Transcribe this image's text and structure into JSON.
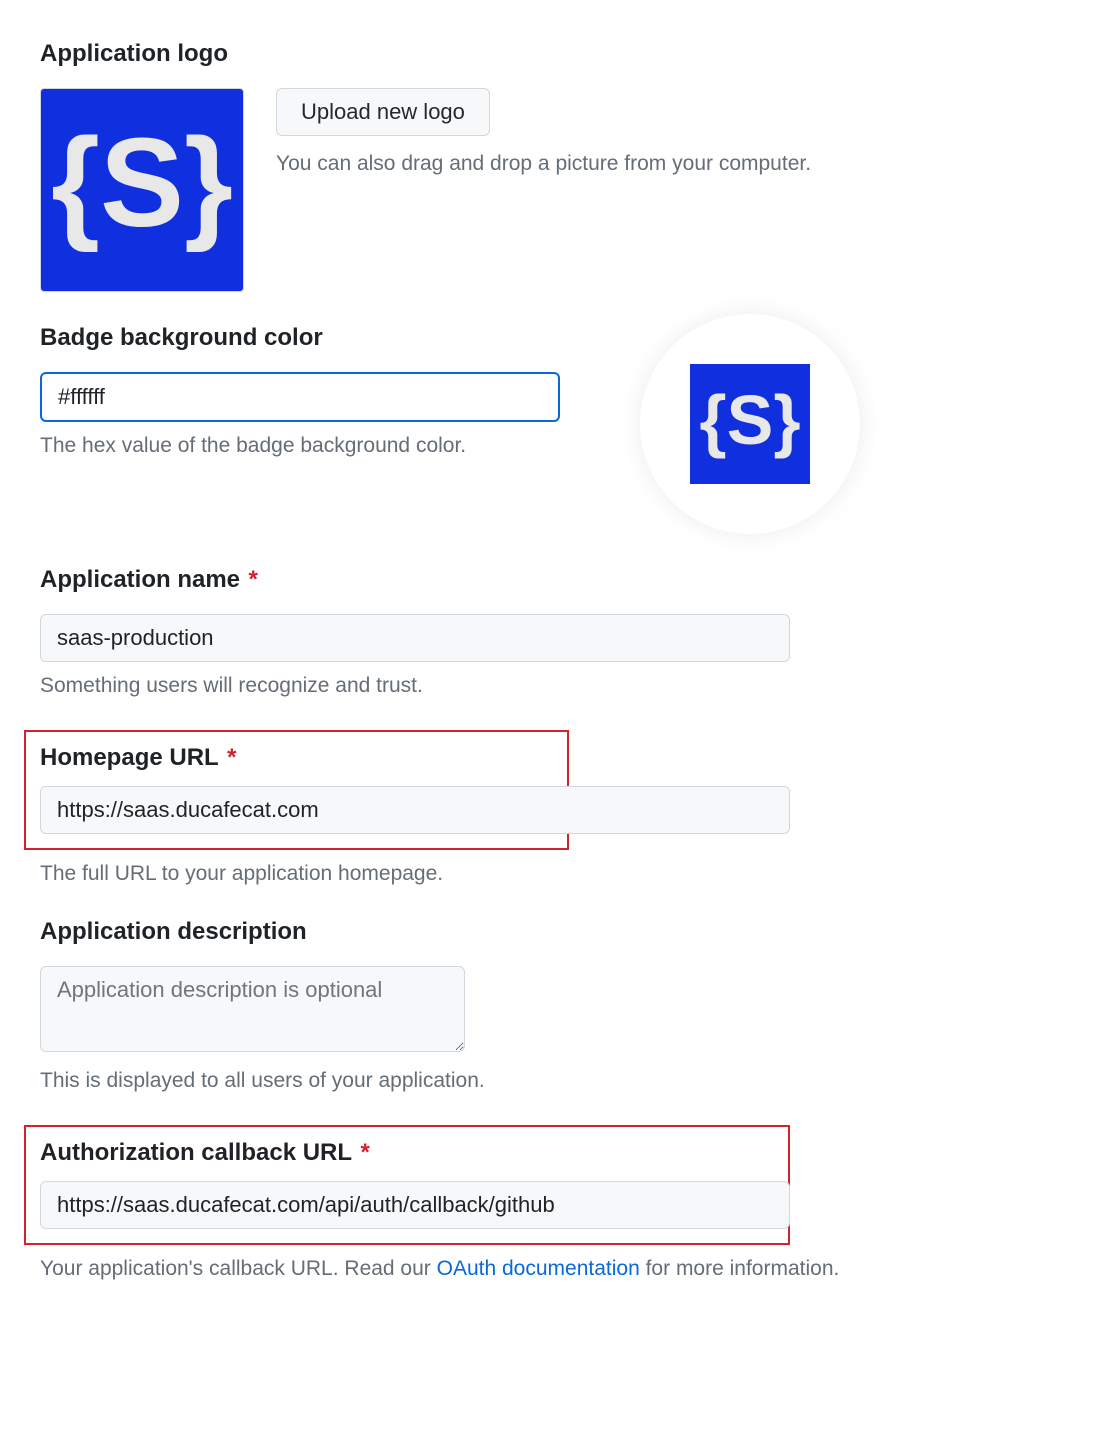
{
  "logo": {
    "label": "Application logo",
    "upload_button": "Upload new logo",
    "hint": "You can also drag and drop a picture from your computer."
  },
  "badge": {
    "label": "Badge background color",
    "value": "#ffffff",
    "help": "The hex value of the badge background color."
  },
  "app_name": {
    "label": "Application name",
    "value": "saas-production",
    "help": "Something users will recognize and trust."
  },
  "homepage": {
    "label": "Homepage URL",
    "value": "https://saas.ducafecat.com",
    "help": "The full URL to your application homepage."
  },
  "description": {
    "label": "Application description",
    "placeholder": "Application description is optional",
    "help": "This is displayed to all users of your application."
  },
  "callback": {
    "label": "Authorization callback URL",
    "value": "https://saas.ducafecat.com/api/auth/callback/github",
    "help_prefix": "Your application's callback URL. Read our ",
    "help_link": "OAuth documentation",
    "help_suffix": " for more information."
  }
}
